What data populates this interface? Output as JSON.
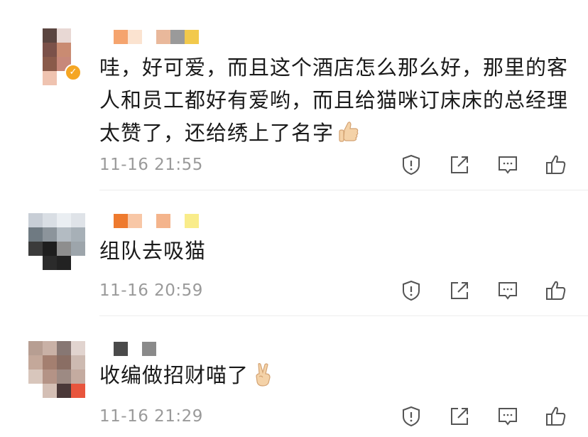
{
  "comments": [
    {
      "text": "哇，好可爱，而且这个酒店怎么那么好，那里的客人和员工都好有爱哟，而且给猫咪订床床的总经理太赞了，还给绣上了名字",
      "emoji": "thumbs-up-emoji",
      "timestamp": "11-16 21:55",
      "verified": true,
      "name_colors": [
        "#f5a46e",
        "#fbe3d0",
        "#ffffff",
        "#e9b89b",
        "#9a9a9a",
        "#f2c94c"
      ],
      "avatar_colors": [
        "#ffffff",
        "#5a4540",
        "#e8d8d4",
        "#ffffff",
        "#ffffff",
        "#7b5149",
        "#c98b72",
        "#ffffff",
        "#ffffff",
        "#8a5a4a",
        "#c7887a",
        "#ffffff",
        "#ffffff",
        "#efc3b0",
        "#ffffff",
        "#ffffff"
      ]
    },
    {
      "text": "组队去吸猫",
      "emoji": "",
      "timestamp": "11-16 20:59",
      "verified": false,
      "name_colors": [
        "#ee7a2e",
        "#f8c7a6",
        "#ffffff",
        "#f4b48c",
        "#ffffff",
        "#f9ec8a"
      ],
      "avatar_colors": [
        "#c8ced6",
        "#d9dee4",
        "#eaeef2",
        "#dfe3e8",
        "#6f7a82",
        "#8c949b",
        "#b3bbc2",
        "#a7b0b7",
        "#3b3b3b",
        "#1e1e1e",
        "#8e8e8e",
        "#9da5ab",
        "#ffffff",
        "#2b2b2b",
        "#222222",
        "#ffffff"
      ]
    },
    {
      "text": "收编做招财喵了",
      "emoji": "victory-hand-emoji",
      "timestamp": "11-16 21:29",
      "verified": false,
      "name_colors": [
        "#4a4a4a",
        "#ffffff",
        "#8a8a8a"
      ],
      "avatar_colors": [
        "#b79e92",
        "#c9b1a6",
        "#877773",
        "#e1d4cf",
        "#c4a89a",
        "#a47f70",
        "#8a6e64",
        "#cdbab1",
        "#d8c6bc",
        "#b49386",
        "#9d8a83",
        "#c4aba0",
        "#ffffff",
        "#d4bfb5",
        "#4a3838",
        "#e8553d"
      ]
    }
  ],
  "actions": [
    "report-icon",
    "share-icon",
    "comment-icon",
    "like-icon"
  ]
}
